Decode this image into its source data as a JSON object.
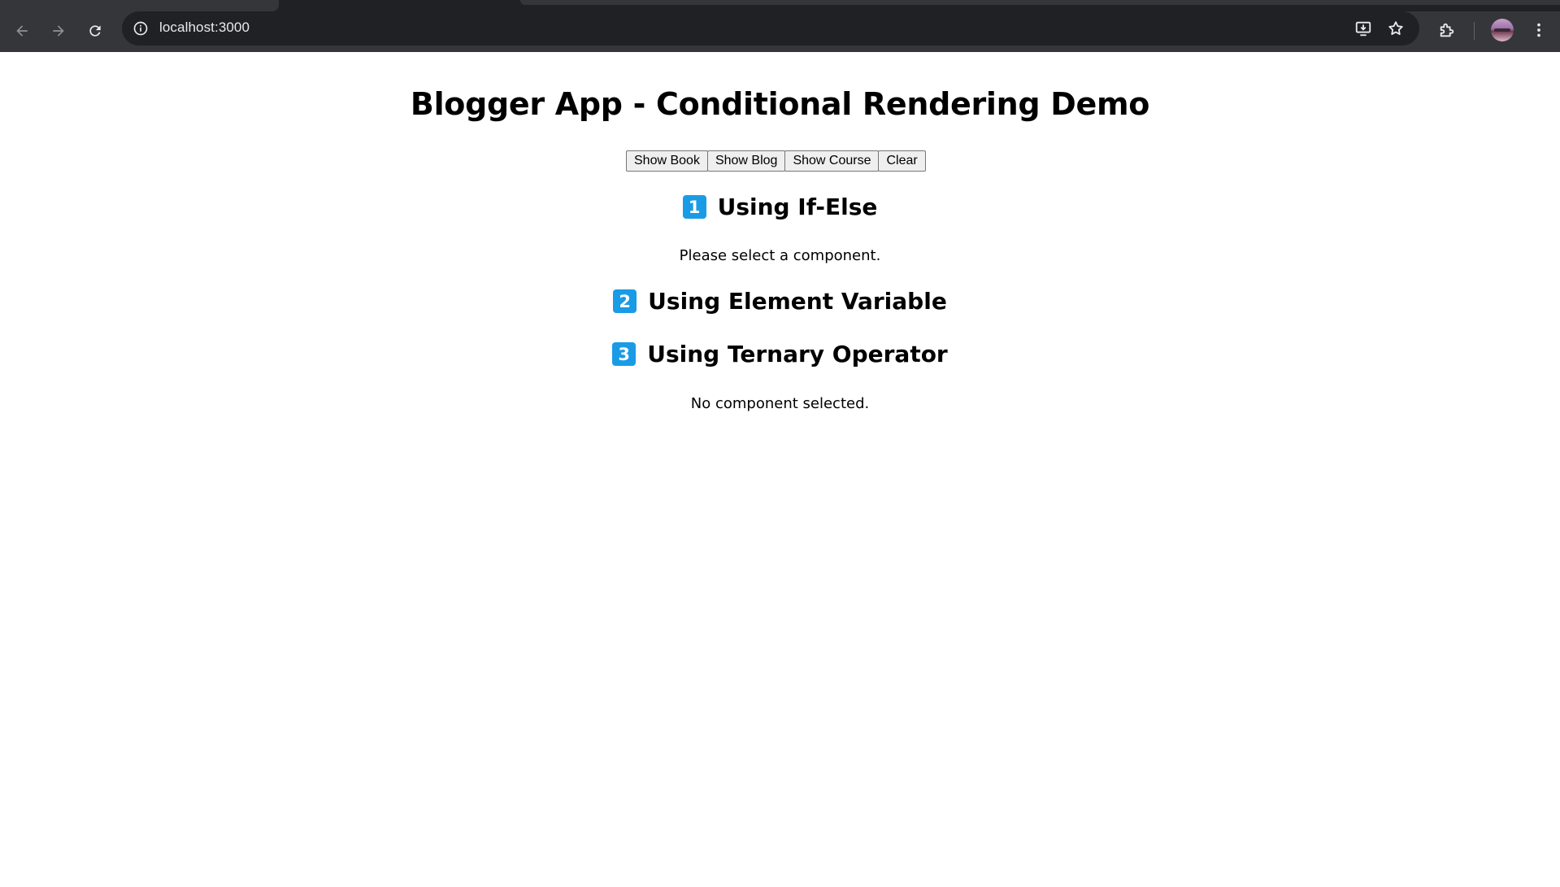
{
  "browser": {
    "url": "localhost:3000"
  },
  "page": {
    "title": "Blogger App - Conditional Rendering Demo",
    "buttons": [
      {
        "label": "Show Book"
      },
      {
        "label": "Show Blog"
      },
      {
        "label": "Show Course"
      },
      {
        "label": "Clear"
      }
    ],
    "sections": [
      {
        "badge": "1",
        "heading": "Using If-Else",
        "message": "Please select a component."
      },
      {
        "badge": "2",
        "heading": "Using Element Variable",
        "message": ""
      },
      {
        "badge": "3",
        "heading": "Using Ternary Operator",
        "message": "No component selected."
      }
    ]
  },
  "colors": {
    "chrome_bg": "#35363a",
    "omnibox_bg": "#202124",
    "badge_blue": "#1a9be6"
  }
}
